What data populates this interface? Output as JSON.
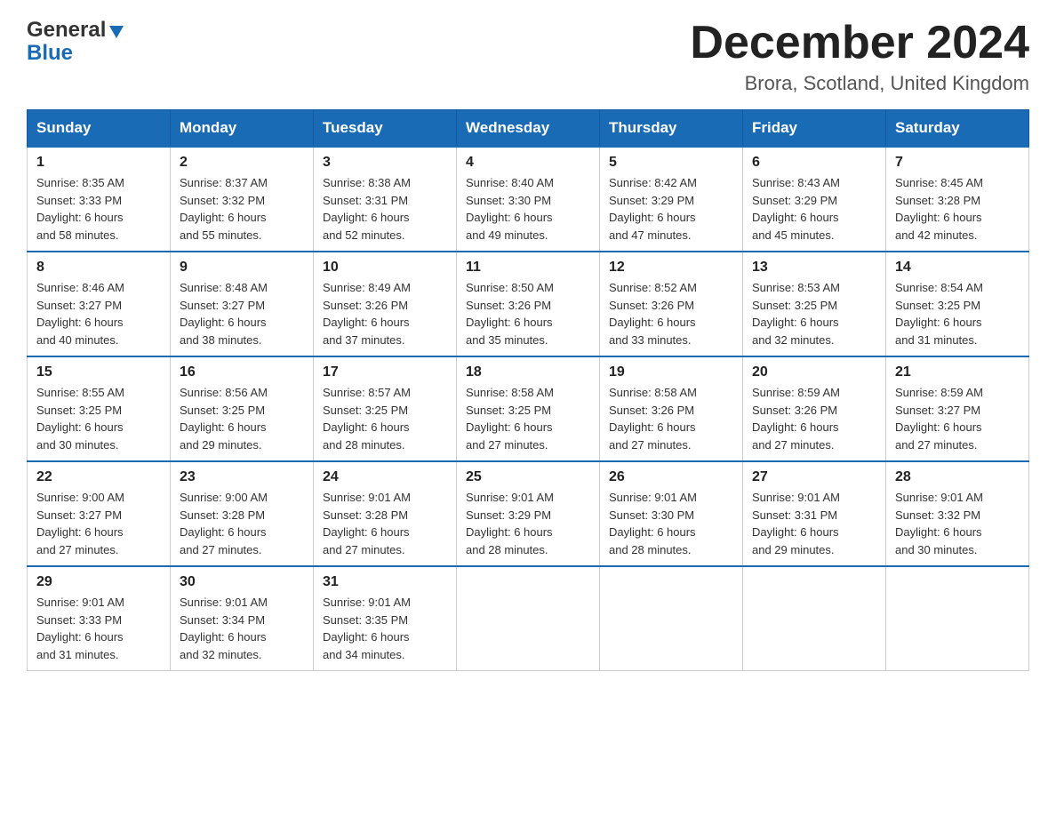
{
  "header": {
    "logo_general": "General",
    "logo_blue": "Blue",
    "title": "December 2024",
    "subtitle": "Brora, Scotland, United Kingdom"
  },
  "days_of_week": [
    "Sunday",
    "Monday",
    "Tuesday",
    "Wednesday",
    "Thursday",
    "Friday",
    "Saturday"
  ],
  "weeks": [
    [
      {
        "day": "1",
        "sunrise": "8:35 AM",
        "sunset": "3:33 PM",
        "daylight": "6 hours and 58 minutes."
      },
      {
        "day": "2",
        "sunrise": "8:37 AM",
        "sunset": "3:32 PM",
        "daylight": "6 hours and 55 minutes."
      },
      {
        "day": "3",
        "sunrise": "8:38 AM",
        "sunset": "3:31 PM",
        "daylight": "6 hours and 52 minutes."
      },
      {
        "day": "4",
        "sunrise": "8:40 AM",
        "sunset": "3:30 PM",
        "daylight": "6 hours and 49 minutes."
      },
      {
        "day": "5",
        "sunrise": "8:42 AM",
        "sunset": "3:29 PM",
        "daylight": "6 hours and 47 minutes."
      },
      {
        "day": "6",
        "sunrise": "8:43 AM",
        "sunset": "3:29 PM",
        "daylight": "6 hours and 45 minutes."
      },
      {
        "day": "7",
        "sunrise": "8:45 AM",
        "sunset": "3:28 PM",
        "daylight": "6 hours and 42 minutes."
      }
    ],
    [
      {
        "day": "8",
        "sunrise": "8:46 AM",
        "sunset": "3:27 PM",
        "daylight": "6 hours and 40 minutes."
      },
      {
        "day": "9",
        "sunrise": "8:48 AM",
        "sunset": "3:27 PM",
        "daylight": "6 hours and 38 minutes."
      },
      {
        "day": "10",
        "sunrise": "8:49 AM",
        "sunset": "3:26 PM",
        "daylight": "6 hours and 37 minutes."
      },
      {
        "day": "11",
        "sunrise": "8:50 AM",
        "sunset": "3:26 PM",
        "daylight": "6 hours and 35 minutes."
      },
      {
        "day": "12",
        "sunrise": "8:52 AM",
        "sunset": "3:26 PM",
        "daylight": "6 hours and 33 minutes."
      },
      {
        "day": "13",
        "sunrise": "8:53 AM",
        "sunset": "3:25 PM",
        "daylight": "6 hours and 32 minutes."
      },
      {
        "day": "14",
        "sunrise": "8:54 AM",
        "sunset": "3:25 PM",
        "daylight": "6 hours and 31 minutes."
      }
    ],
    [
      {
        "day": "15",
        "sunrise": "8:55 AM",
        "sunset": "3:25 PM",
        "daylight": "6 hours and 30 minutes."
      },
      {
        "day": "16",
        "sunrise": "8:56 AM",
        "sunset": "3:25 PM",
        "daylight": "6 hours and 29 minutes."
      },
      {
        "day": "17",
        "sunrise": "8:57 AM",
        "sunset": "3:25 PM",
        "daylight": "6 hours and 28 minutes."
      },
      {
        "day": "18",
        "sunrise": "8:58 AM",
        "sunset": "3:25 PM",
        "daylight": "6 hours and 27 minutes."
      },
      {
        "day": "19",
        "sunrise": "8:58 AM",
        "sunset": "3:26 PM",
        "daylight": "6 hours and 27 minutes."
      },
      {
        "day": "20",
        "sunrise": "8:59 AM",
        "sunset": "3:26 PM",
        "daylight": "6 hours and 27 minutes."
      },
      {
        "day": "21",
        "sunrise": "8:59 AM",
        "sunset": "3:27 PM",
        "daylight": "6 hours and 27 minutes."
      }
    ],
    [
      {
        "day": "22",
        "sunrise": "9:00 AM",
        "sunset": "3:27 PM",
        "daylight": "6 hours and 27 minutes."
      },
      {
        "day": "23",
        "sunrise": "9:00 AM",
        "sunset": "3:28 PM",
        "daylight": "6 hours and 27 minutes."
      },
      {
        "day": "24",
        "sunrise": "9:01 AM",
        "sunset": "3:28 PM",
        "daylight": "6 hours and 27 minutes."
      },
      {
        "day": "25",
        "sunrise": "9:01 AM",
        "sunset": "3:29 PM",
        "daylight": "6 hours and 28 minutes."
      },
      {
        "day": "26",
        "sunrise": "9:01 AM",
        "sunset": "3:30 PM",
        "daylight": "6 hours and 28 minutes."
      },
      {
        "day": "27",
        "sunrise": "9:01 AM",
        "sunset": "3:31 PM",
        "daylight": "6 hours and 29 minutes."
      },
      {
        "day": "28",
        "sunrise": "9:01 AM",
        "sunset": "3:32 PM",
        "daylight": "6 hours and 30 minutes."
      }
    ],
    [
      {
        "day": "29",
        "sunrise": "9:01 AM",
        "sunset": "3:33 PM",
        "daylight": "6 hours and 31 minutes."
      },
      {
        "day": "30",
        "sunrise": "9:01 AM",
        "sunset": "3:34 PM",
        "daylight": "6 hours and 32 minutes."
      },
      {
        "day": "31",
        "sunrise": "9:01 AM",
        "sunset": "3:35 PM",
        "daylight": "6 hours and 34 minutes."
      },
      null,
      null,
      null,
      null
    ]
  ],
  "labels": {
    "sunrise": "Sunrise:",
    "sunset": "Sunset:",
    "daylight": "Daylight:"
  }
}
